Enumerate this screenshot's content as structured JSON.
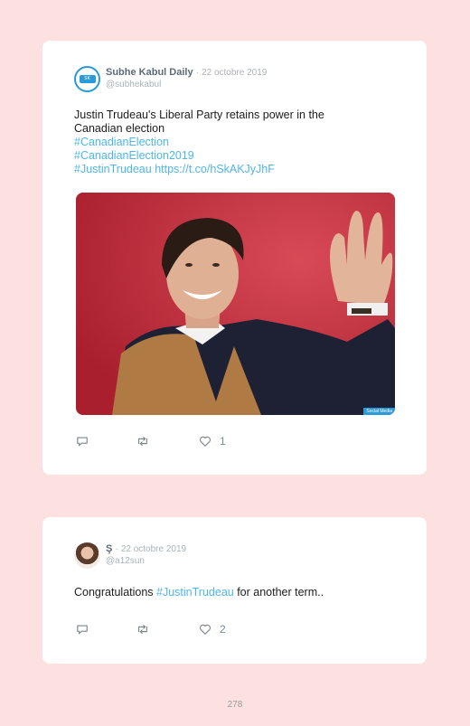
{
  "tweets": [
    {
      "display_name": "Subhe Kabul Daily",
      "separator": "·",
      "date": "22 octobre 2019",
      "handle": "@subhekabul",
      "text_line1": "Justin Trudeau's Liberal Party retains power in the",
      "text_line2": "Canadian election",
      "hashtag1": "#CanadianElection",
      "hashtag2": "#CanadianElection2019",
      "hashtag3": "#JustinTrudeau",
      "url": "https://t.co/hSkAKJyJhF",
      "image_credit": "Social Media",
      "likes": "1"
    },
    {
      "display_name": "Ş",
      "separator": "·",
      "date": "22 octobre 2019",
      "handle": "@a12sun",
      "text_before": "Congratulations ",
      "hashtag": "#JustinTrudeau",
      "text_after": " for another term..",
      "likes": "2"
    }
  ],
  "page_number": "278",
  "colors": {
    "background": "#fde0e0",
    "link": "#4fb6e8",
    "card": "#ffffff"
  },
  "icons": [
    "reply-icon",
    "retweet-icon",
    "heart-icon"
  ]
}
